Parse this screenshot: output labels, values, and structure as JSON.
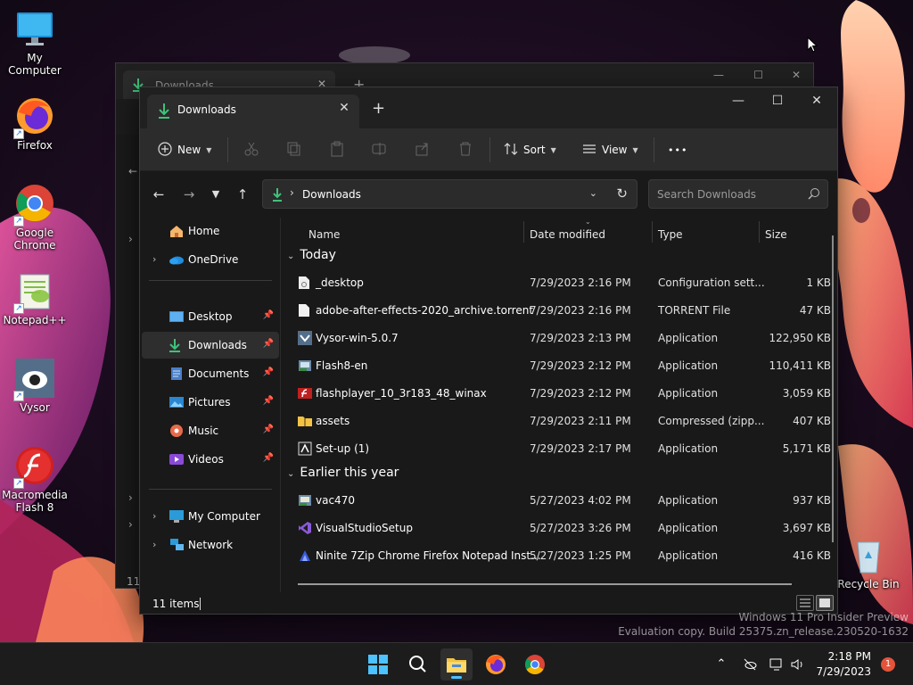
{
  "desktop": {
    "icons": [
      {
        "label": "My Computer"
      },
      {
        "label": "Firefox"
      },
      {
        "label": "Google Chrome"
      },
      {
        "label": "Notepad++"
      },
      {
        "label": "Vysor"
      },
      {
        "label": "Macromedia Flash 8"
      },
      {
        "label": "Recycle Bin"
      }
    ],
    "watermark": {
      "line1": "Windows 11 Pro Insider Preview",
      "line2": "Evaluation copy. Build 25375.zn_release.230520-1632"
    }
  },
  "back_window": {
    "tab_title": "Downloads",
    "status": "11"
  },
  "window": {
    "tab_title": "Downloads",
    "toolbar": {
      "new_label": "New",
      "sort_label": "Sort",
      "view_label": "View",
      "more_label": "•••"
    },
    "address": {
      "crumb": "Downloads"
    },
    "search": {
      "placeholder": "Search Downloads"
    },
    "nav": {
      "home": "Home",
      "onedrive": "OneDrive",
      "desktop": "Desktop",
      "downloads": "Downloads",
      "documents": "Documents",
      "pictures": "Pictures",
      "music": "Music",
      "videos": "Videos",
      "my_computer": "My Computer",
      "network": "Network"
    },
    "columns": {
      "name": "Name",
      "date": "Date modified",
      "type": "Type",
      "size": "Size"
    },
    "groups": {
      "today": "Today",
      "earlier": "Earlier this year"
    },
    "files": [
      {
        "name": "_desktop",
        "date": "7/29/2023 2:16 PM",
        "type": "Configuration sett...",
        "size": "1 KB"
      },
      {
        "name": "adobe-after-effects-2020_archive.torrent",
        "date": "7/29/2023 2:16 PM",
        "type": "TORRENT File",
        "size": "47 KB"
      },
      {
        "name": "Vysor-win-5.0.7",
        "date": "7/29/2023 2:13 PM",
        "type": "Application",
        "size": "122,950 KB"
      },
      {
        "name": "Flash8-en",
        "date": "7/29/2023 2:12 PM",
        "type": "Application",
        "size": "110,411 KB"
      },
      {
        "name": "flashplayer_10_3r183_48_winax",
        "date": "7/29/2023 2:12 PM",
        "type": "Application",
        "size": "3,059 KB"
      },
      {
        "name": "assets",
        "date": "7/29/2023 2:11 PM",
        "type": "Compressed (zipp...",
        "size": "407 KB"
      },
      {
        "name": "Set-up (1)",
        "date": "7/29/2023 2:17 PM",
        "type": "Application",
        "size": "5,171 KB"
      },
      {
        "name": "vac470",
        "date": "5/27/2023 4:02 PM",
        "type": "Application",
        "size": "937 KB"
      },
      {
        "name": "VisualStudioSetup",
        "date": "5/27/2023 3:26 PM",
        "type": "Application",
        "size": "3,697 KB"
      },
      {
        "name": "Ninite 7Zip Chrome Firefox Notepad Inst...",
        "date": "5/27/2023 1:25 PM",
        "type": "Application",
        "size": "416 KB"
      }
    ],
    "status": {
      "count": "11 items"
    }
  },
  "taskbar": {
    "time": "2:18 PM",
    "date": "7/29/2023",
    "notification_count": "1"
  },
  "colors": {
    "accent": "#4cc2ff",
    "downloads_green": "#3ec27a",
    "folder_yellow": "#f3c343"
  }
}
